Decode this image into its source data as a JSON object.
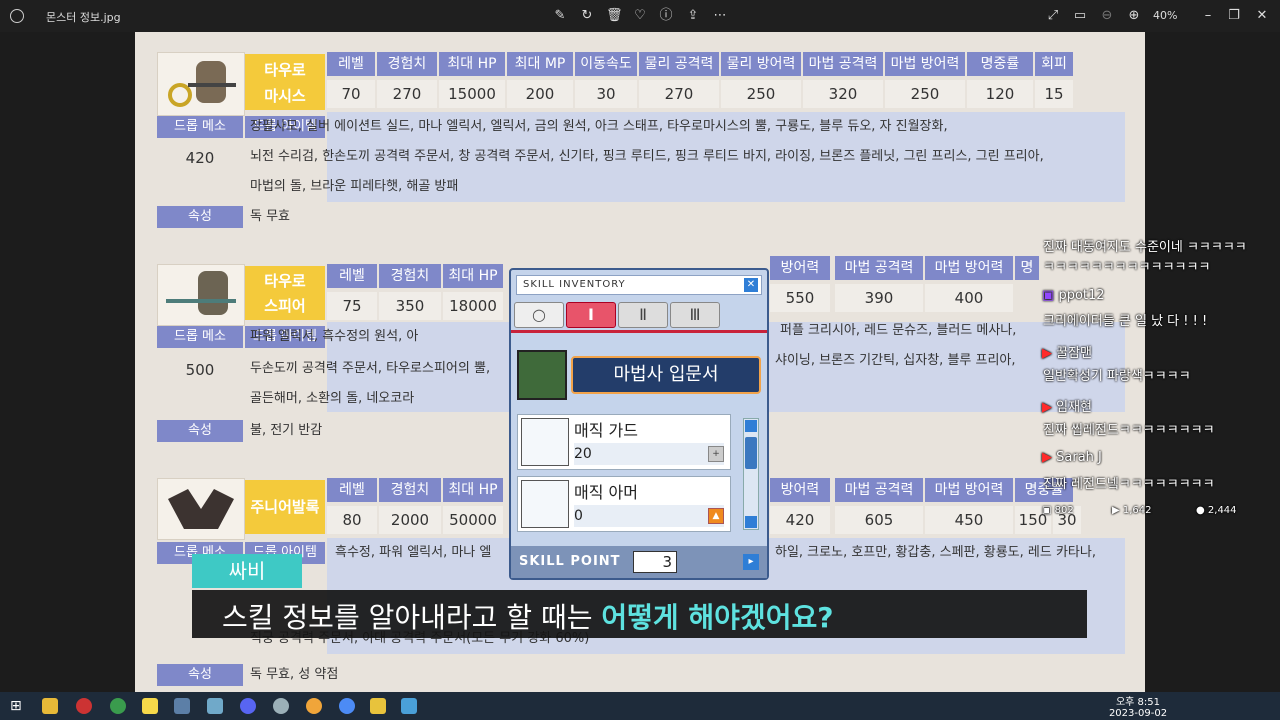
{
  "window": {
    "filename": "몬스터 정보.jpg",
    "zoom": "40%"
  },
  "monster1": {
    "name1": "타우로",
    "name2": "마시스",
    "headers": [
      "레벨",
      "경험치",
      "최대 HP",
      "최대 MP",
      "이동속도",
      "물리 공격력",
      "물리 방어력",
      "마법 공격력",
      "마법 방어력",
      "명중률",
      "회피율"
    ],
    "values": [
      "70",
      "270",
      "15000",
      "200",
      "30",
      "270",
      "250",
      "320",
      "250",
      "120",
      "15"
    ],
    "meso_label": "드롭 메소",
    "meso": "420",
    "item_label": "드롭 아이템",
    "items_line1": "장팔사모, 실버 에이션트 실드, 마나 엘릭서, 엘릭서, 금의 원석, 아크 스태프, 타우로마시스의 뿔, 구룡도, 블루 듀오, 자 진월장화,",
    "items_line2": "뇌전 수리검, 한손도끼 공격력 주문서, 창 공격력 주문서, 신기타, 핑크 루티드, 핑크 루티드 바지, 라이징, 브론즈 플레닛, 그린 프리스, 그린 프리아,",
    "items_line3": "마법의 돌, 브라운 피레타햇, 해골 방패",
    "attr_label": "속성",
    "attr": "독 무효"
  },
  "monster2": {
    "name1": "타우로",
    "name2": "스피어",
    "headers": [
      "레벨",
      "경험치",
      "최대 HP",
      "방어력",
      "마법 공격력",
      "마법 방어력",
      "명"
    ],
    "values": [
      "75",
      "350",
      "18000",
      "550",
      "390",
      "400"
    ],
    "meso_label": "드롭 메소",
    "meso": "500",
    "item_label": "드롭 아이템",
    "items_line1": "파워 엘릭서, 흑수정의 원석, 아",
    "items_line1b": "퍼플 크리시아, 레드 문슈즈, 블러드 메사나,",
    "items_line2": "두손도끼 공격력 주문서, 타우로스피어의 뿔,",
    "items_line2b": "샤이닝, 브론즈 기간틱, 십자창, 블루 프리아,",
    "items_line3": "골든해머, 소환의 돌, 네오코라",
    "attr_label": "속성",
    "attr": "불, 전기 반감"
  },
  "monster3": {
    "name": "주니어발록",
    "headers": [
      "레벨",
      "경험치",
      "최대 HP",
      "방어력",
      "마법 공격력",
      "마법 방어력",
      "명중률"
    ],
    "values": [
      "80",
      "2000",
      "50000",
      "420",
      "605",
      "450",
      "150",
      "30"
    ],
    "meso_label": "드롭 메소",
    "item_label": "드롭 아이템",
    "items_line1": "흑수정, 파워 엘릭서, 마나 엘",
    "items_line1b": "하일, 크로노, 호프만, 황갑충, 스페판, 황룡도, 레드 카타나,",
    "items_line3": "직궁 공격력 주문서, 아대 공격력 주문서(모든 무기 강화 60%)",
    "attr_label": "속성",
    "attr": "독 무효, 성 약점"
  },
  "skill_window": {
    "title": "SKILL INVENTORY",
    "tabs": [
      "○",
      "Ⅰ",
      "Ⅱ",
      "Ⅲ"
    ],
    "book_title": "마법사 입문서",
    "skills": [
      {
        "name": "매직 가드",
        "level": "20"
      },
      {
        "name": "매직 아머",
        "level": "0"
      }
    ],
    "skill_point_label": "SKILL POINT",
    "skill_point": "3"
  },
  "subtitle": {
    "speaker": "싸비",
    "text_plain": "스킬 정보를 알아내라고 할 때는 ",
    "text_accent": "어떻게 해야겠어요?"
  },
  "chat": [
    {
      "user": "",
      "msg": "진짜 대동여지도 수준이네 ㅋㅋㅋㅋㅋ"
    },
    {
      "user": "",
      "msg": "ㅋㅋㅋㅋㅋㅋㅋㅋㅋㅋㅋㅋㅋㅋ"
    },
    {
      "user": "ppot12",
      "msg": "크리에이터들 큰 일 났 다 ! ! !"
    },
    {
      "user": "꿀잠맨",
      "msg": "일반확성기 파랑색ㅋㅋㅋㅋ"
    },
    {
      "user": "임재현",
      "msg": "진짜 씹레전드ㅋㅋㅋㅋㅋㅋㅋㅋ"
    },
    {
      "user": "Sarah J",
      "msg": "진짜 레전드넼ㅋㅋㅋㅋㅋㅋㅋㅋ"
    }
  ],
  "stats": {
    "viewers": "802",
    "likes": "1,642",
    "people": "2,444"
  },
  "taskbar": {
    "time": "오후 8:51",
    "date": "2023-09-02"
  }
}
